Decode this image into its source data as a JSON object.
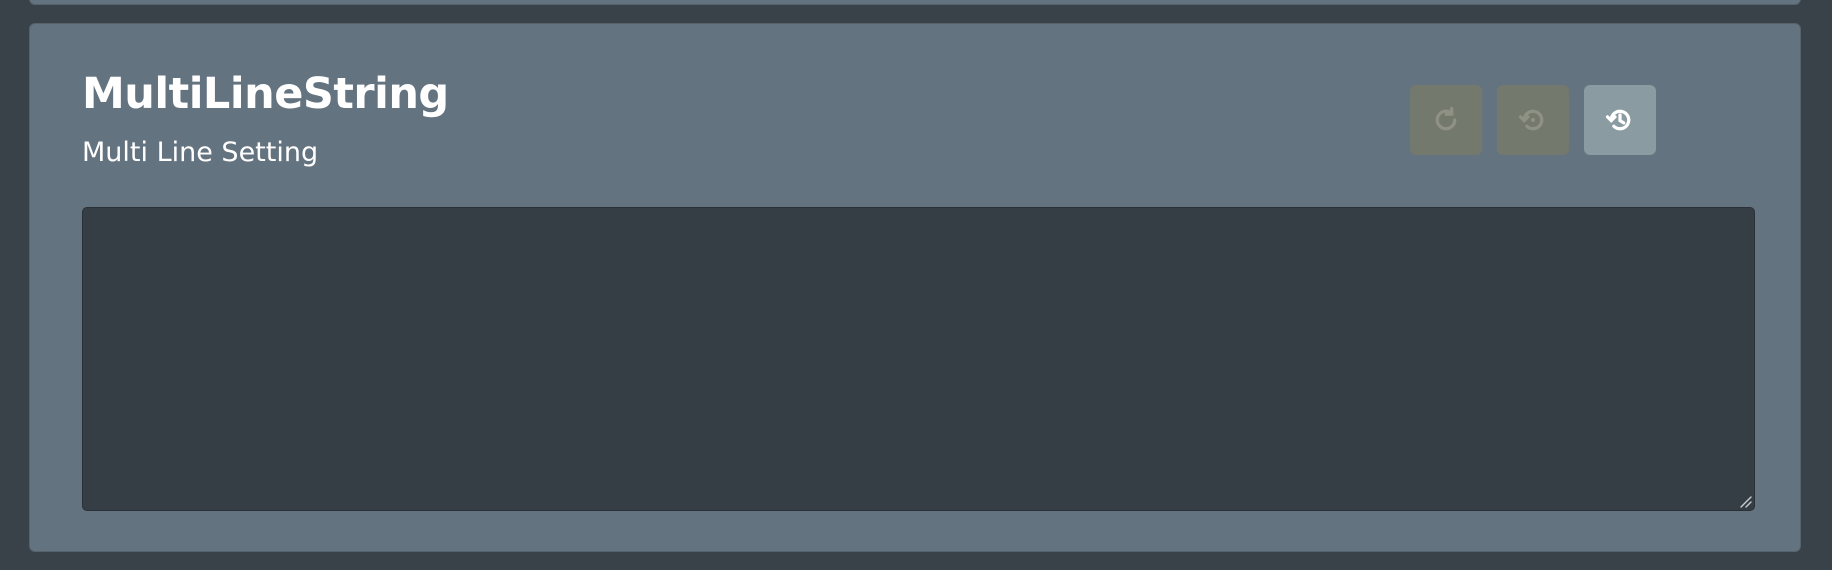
{
  "setting": {
    "title": "MultiLineString",
    "description": "Multi Line Setting",
    "value": ""
  },
  "actions": [
    {
      "icon": "reset-icon",
      "enabled": false
    },
    {
      "icon": "restore-default-icon",
      "enabled": false
    },
    {
      "icon": "history-icon",
      "enabled": true
    }
  ],
  "colors": {
    "page_background": "#3a4249",
    "card_background": "#647380",
    "editor_background": "#363e45",
    "disabled_button": "#74796e",
    "enabled_button": "#8a9ba1",
    "text": "#ffffff"
  }
}
